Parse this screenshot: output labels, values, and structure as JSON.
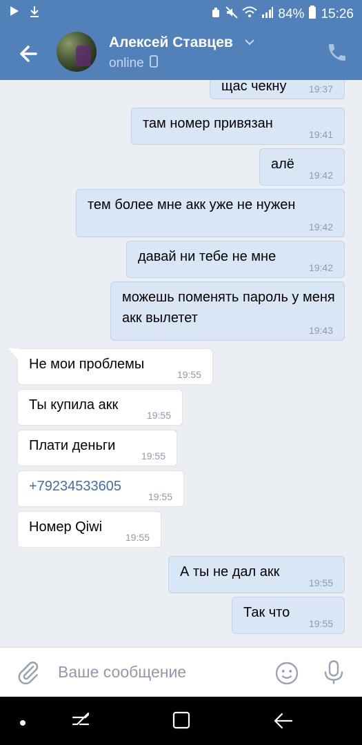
{
  "status_bar": {
    "battery": "84%",
    "time": "15:26",
    "icons": [
      "play-icon",
      "download-icon",
      "alarm-icon",
      "mute-icon",
      "wifi-icon",
      "signal-icon",
      "battery-icon"
    ]
  },
  "header": {
    "name": "Алексей Ставцев",
    "status": "online",
    "icons": [
      "back-arrow-icon",
      "chevron-down-icon",
      "mobile-icon",
      "phone-icon"
    ]
  },
  "messages": [
    {
      "dir": "out",
      "text": "щас чекну",
      "time": "19:37"
    },
    {
      "dir": "out",
      "text": "там номер привязан",
      "time": "19:41"
    },
    {
      "dir": "out",
      "text": "алё",
      "time": "19:42"
    },
    {
      "dir": "out",
      "text": "тем более мне акк уже не нужен",
      "time": "19:42"
    },
    {
      "dir": "out",
      "text": "давай ни тебе не мне",
      "time": "19:42"
    },
    {
      "dir": "out",
      "text": "можешь поменять пароль у меня акк вылетет",
      "time": "19:43"
    },
    {
      "dir": "in",
      "text": "Не мои проблемы",
      "time": "19:55"
    },
    {
      "dir": "in",
      "text": "Ты купила акк",
      "time": "19:55"
    },
    {
      "dir": "in",
      "text": "Плати деньги",
      "time": "19:55"
    },
    {
      "dir": "in",
      "text": "+79234533605",
      "time": "19:55",
      "link": true
    },
    {
      "dir": "in",
      "text": "Номер Qiwi",
      "time": "19:55"
    },
    {
      "dir": "out",
      "text": "А ты не дал акк",
      "time": "19:55"
    },
    {
      "dir": "out",
      "text": "Так что",
      "time": "19:55"
    }
  ],
  "composer": {
    "placeholder": "Ваше сообщение",
    "icons": [
      "attach-icon",
      "emoji-icon",
      "microphone-icon"
    ]
  },
  "nav_bar": {
    "icons": [
      "dot-icon",
      "recent-apps-icon",
      "home-icon",
      "back-icon"
    ]
  },
  "colors": {
    "header_bg": "#5181b8",
    "chat_bg": "#ebeef2",
    "out_bubble": "#d8e6f5",
    "in_bubble": "#ffffff",
    "link": "#3f6fa5"
  }
}
